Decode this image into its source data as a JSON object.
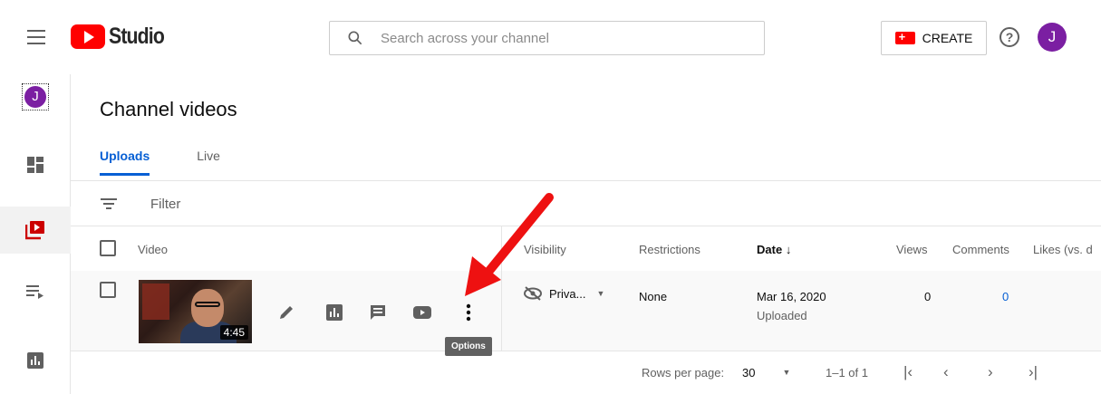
{
  "app": {
    "brand": "Studio",
    "accent": "#065fd4",
    "brand_red": "#ff0000",
    "avatar_color": "#7b1fa2"
  },
  "header": {
    "search_placeholder": "Search across your channel",
    "create_label": "CREATE",
    "help_glyph": "?",
    "avatar_letter": "J"
  },
  "rail": {
    "avatar_letter": "J",
    "items": [
      "dashboard-icon",
      "content-icon",
      "playlists-icon",
      "analytics-icon"
    ]
  },
  "page": {
    "title": "Channel videos",
    "tabs": [
      {
        "label": "Uploads",
        "active": true
      },
      {
        "label": "Live",
        "active": false
      }
    ],
    "filter_label": "Filter"
  },
  "table": {
    "columns": {
      "video": "Video",
      "visibility": "Visibility",
      "restrictions": "Restrictions",
      "date": "Date",
      "views": "Views",
      "comments": "Comments",
      "likes": "Likes (vs. d"
    },
    "rows": [
      {
        "duration": "4:45",
        "visibility": "Priva...",
        "restrictions": "None",
        "date": "Mar 16, 2020",
        "date_status": "Uploaded",
        "views": "0",
        "comments": "0"
      }
    ],
    "tooltip": "Options"
  },
  "footer": {
    "rows_per_page_label": "Rows per page:",
    "rows_per_page_value": "30",
    "range": "1–1 of 1"
  }
}
